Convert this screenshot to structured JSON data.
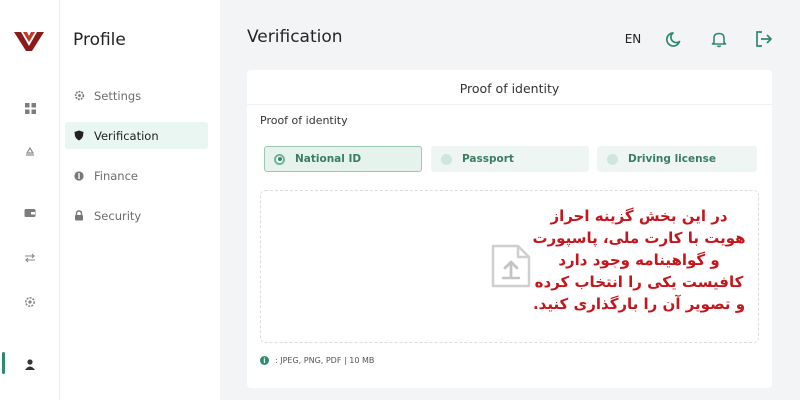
{
  "sidebar": {
    "title": "Profile",
    "items": [
      {
        "label": "Settings",
        "icon": "gear-icon",
        "active": false
      },
      {
        "label": "Verification",
        "icon": "shield-icon",
        "active": true
      },
      {
        "label": "Finance",
        "icon": "coin-icon",
        "active": false
      },
      {
        "label": "Security",
        "icon": "lock-icon",
        "active": false
      }
    ]
  },
  "rail": {
    "icons": [
      "dashboard-icon",
      "recycle-icon",
      "wallet-icon",
      "exchange-icon",
      "settings-icon",
      "user-icon"
    ],
    "active": "user-icon"
  },
  "header": {
    "title": "Verification",
    "language": "EN"
  },
  "card": {
    "title": "Proof of identity",
    "section_label": "Proof of identity",
    "options": [
      {
        "label": "National ID",
        "selected": true
      },
      {
        "label": "Passport",
        "selected": false
      },
      {
        "label": "Driving license",
        "selected": false
      }
    ],
    "note": "در این بخش گزینه احراز هویت با کارت ملی، پاسپورت و گواهینامه وجود دارد کافیست یکی را انتخاب کرده و تصویر آن را بارگذاری کنید.",
    "file_info": ": JPEG, PNG, PDF | 10 MB"
  },
  "colors": {
    "accent": "#2e8b6a",
    "note_text": "#c4161c",
    "brand_dark": "#8b1a1a"
  }
}
